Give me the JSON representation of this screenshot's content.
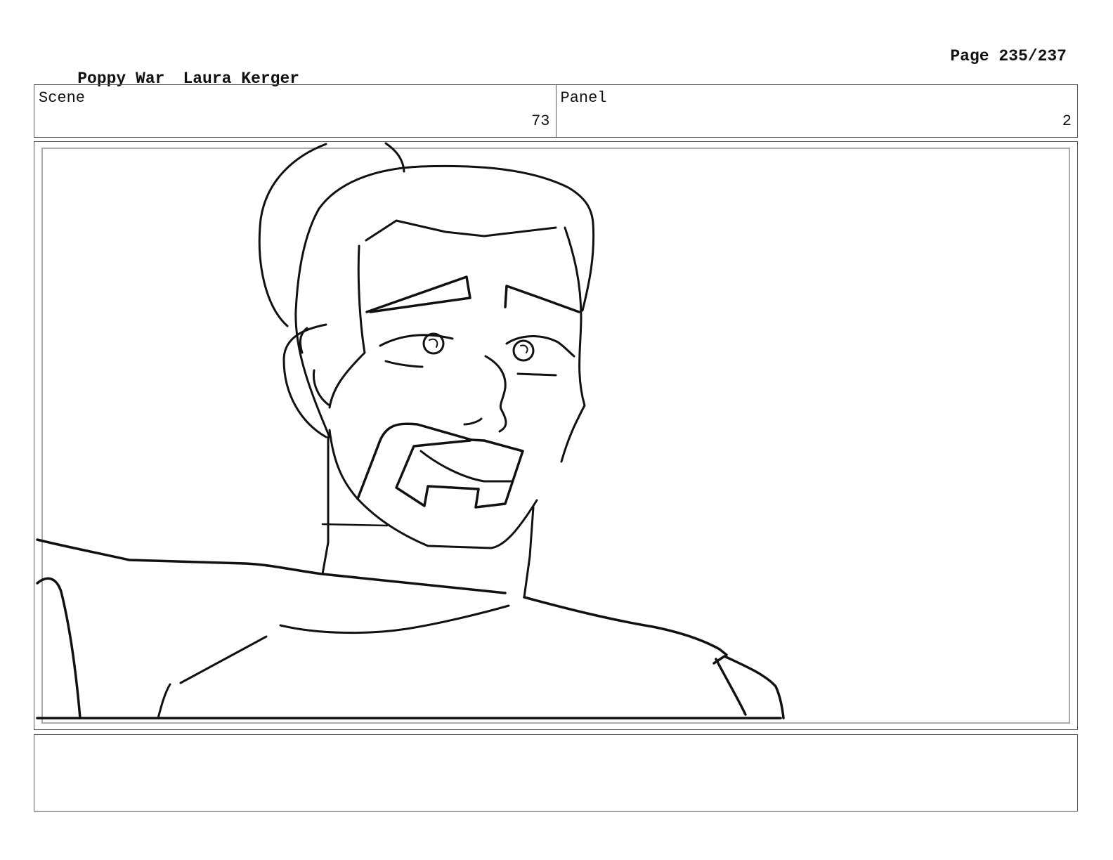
{
  "header": {
    "project": "Poppy War",
    "author": "Laura Kerger",
    "page": "Page 235/237"
  },
  "scene": {
    "label": "Scene",
    "value": "73"
  },
  "panel": {
    "label": "Panel",
    "value": "2"
  },
  "frame": {
    "image": "storyboard-sketch-bearded-man"
  },
  "notes": {
    "text": ""
  }
}
